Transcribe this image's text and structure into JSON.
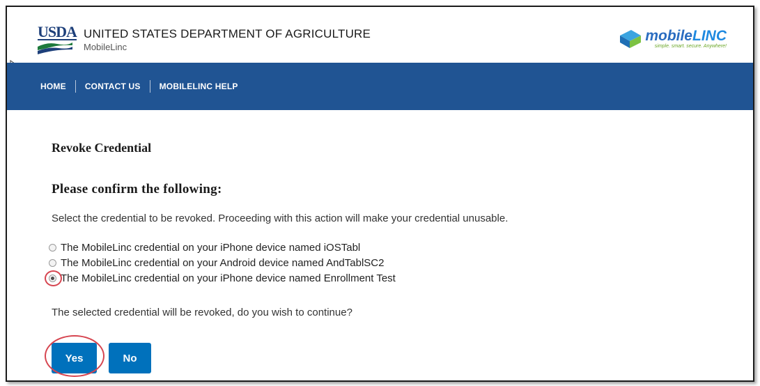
{
  "header": {
    "logo_text": "USDA",
    "agency": "UNITED STATES DEPARTMENT OF AGRICULTURE",
    "app_name": "MobileLinc",
    "brand": {
      "word_a": "mobile",
      "word_b": "LINC",
      "tagline": "simple. smart. secure. Anywhere!"
    }
  },
  "nav": {
    "items": [
      {
        "label": "HOME"
      },
      {
        "label": "CONTACT US"
      },
      {
        "label": "MOBILELINC HELP"
      }
    ]
  },
  "page": {
    "title": "Revoke Credential",
    "confirm_heading": "Please confirm the following:",
    "instructions": "Select the credential to be revoked. Proceeding with this action will make your credential unusable.",
    "options": [
      {
        "label": "The MobileLinc credential on your iPhone device named iOSTabl",
        "checked": false
      },
      {
        "label": "The MobileLinc credential on your Android device named AndTablSC2",
        "checked": false
      },
      {
        "label": "The MobileLinc credential on your iPhone device named Enrollment Test",
        "checked": true
      }
    ],
    "question": "The selected credential will be revoked, do you wish to continue?",
    "yes_label": "Yes",
    "no_label": "No"
  },
  "colors": {
    "nav_bg": "#205493",
    "button_bg": "#0071bc",
    "highlight_ring": "#d64550"
  }
}
